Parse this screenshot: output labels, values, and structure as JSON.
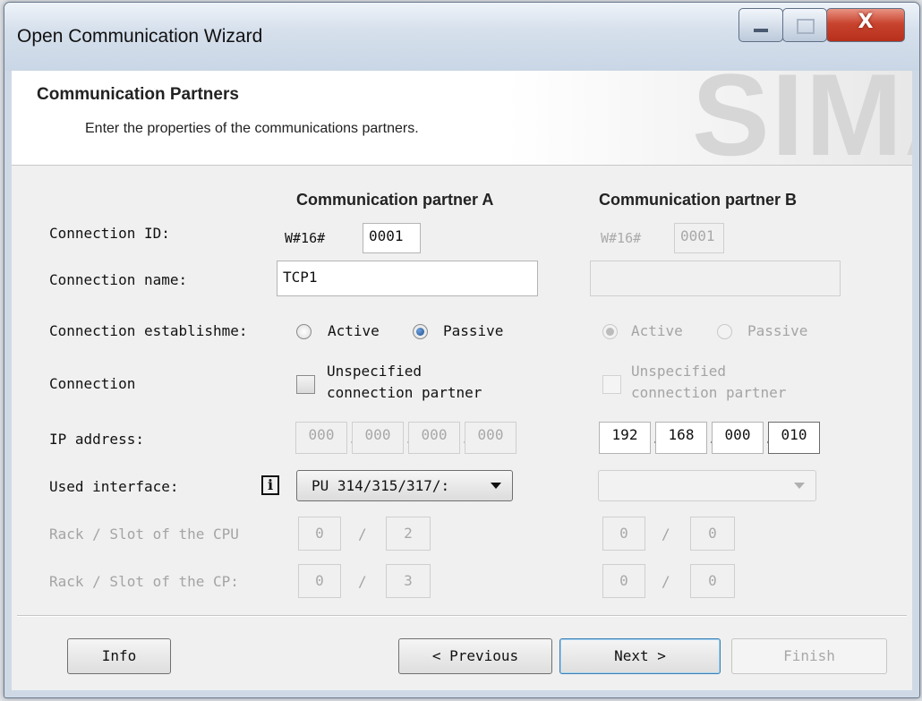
{
  "window": {
    "title": "Open Communication Wizard",
    "close_glyph": "X"
  },
  "header": {
    "title": "Communication Partners",
    "subtitle": "Enter the properties of the communications partners.",
    "watermark": "SIMA"
  },
  "columns": {
    "a": "Communication partner A",
    "b": "Communication partner B"
  },
  "labels": {
    "connection_id": "Connection ID:",
    "connection_name": "Connection name:",
    "establishment": "Connection establishme:",
    "connection": "Connection",
    "ip_address": "IP address:",
    "used_interface": "Used interface:",
    "rack_slot_cpu": "Rack / Slot of the  CPU",
    "rack_slot_cp": "Rack / Slot of the CP:"
  },
  "partner_a": {
    "id_prefix": "W#16#",
    "id_value": "0001",
    "name": "TCP1",
    "radio_active": "Active",
    "radio_passive": "Passive",
    "selected": "Passive",
    "unspecified_line1": "Unspecified",
    "unspecified_line2": "connection partner",
    "unspecified_checked": false,
    "ip": [
      "000",
      "000",
      "000",
      "000"
    ],
    "interface": "PU 314/315/317/:",
    "cpu_rack": "0",
    "cpu_slot": "2",
    "cp_rack": "0",
    "cp_slot": "3"
  },
  "partner_b": {
    "id_prefix": "W#16#",
    "id_value": "0001",
    "name": "",
    "radio_active": "Active",
    "radio_passive": "Passive",
    "selected": "Active",
    "unspecified_line1": "Unspecified",
    "unspecified_line2": "connection partner",
    "unspecified_checked": false,
    "ip": [
      "192",
      "168",
      "000",
      "010"
    ],
    "interface": "",
    "cpu_rack": "0",
    "cpu_slot": "0",
    "cp_rack": "0",
    "cp_slot": "0"
  },
  "separators": {
    "ip_dot": ".",
    "slash": "/"
  },
  "info_glyph": "i",
  "buttons": {
    "info": "Info",
    "previous": "< Previous",
    "next": "Next >",
    "finish": "Finish"
  }
}
